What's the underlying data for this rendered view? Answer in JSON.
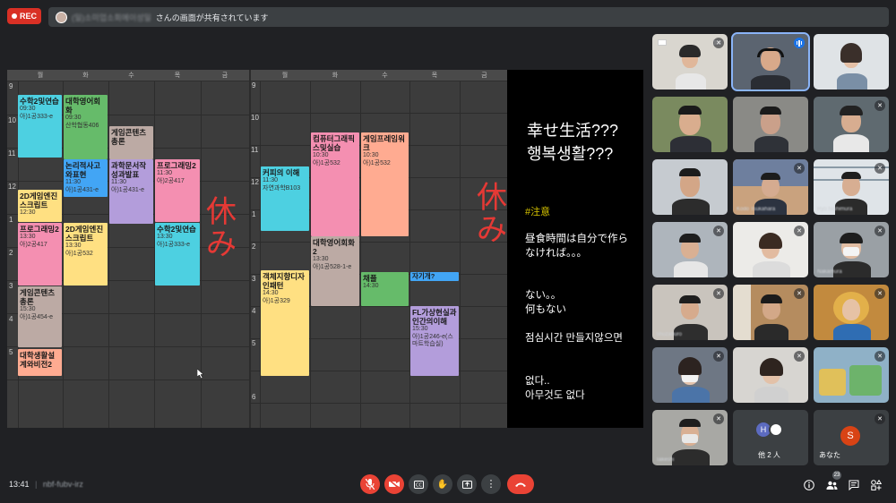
{
  "top_bar": {
    "rec_label": "REC",
    "sharer_name": "(일)소미업소회에이성일",
    "share_message": "さんの画面が共有されています"
  },
  "calendar": {
    "hours_left": [
      "9",
      "10",
      "11",
      "12",
      "1",
      "2",
      "3",
      "4",
      "5"
    ],
    "hours_right": [
      "9",
      "10",
      "11",
      "12",
      "1",
      "2",
      "3",
      "4",
      "5",
      "6"
    ],
    "days": [
      "월",
      "화",
      "수",
      "목",
      "금"
    ],
    "break_mark": "休み",
    "left_events": [
      {
        "title": "수학2및연습",
        "time": "09:30",
        "room": "아)1공333-e"
      },
      {
        "title": "대학영어회화",
        "time": "09:30",
        "room": "산학협동406"
      },
      {
        "title": "게임콘텐츠총론",
        "time": "",
        "room": ""
      },
      {
        "title": "논리적사고와표현",
        "time": "11:30",
        "room": "아)1공431-e"
      },
      {
        "title": "과학문서작성과발표",
        "time": "11:30",
        "room": "아)1공431-e"
      },
      {
        "title": "프로그래밍2",
        "time": "11:30",
        "room": "아)2공417"
      },
      {
        "title": "2D게임엔진스크립트",
        "time": "12:30",
        "room": ""
      },
      {
        "title": "프로그래밍2",
        "time": "13:30",
        "room": "아)2공417"
      },
      {
        "title": "2D게임엔진스크립트",
        "time": "13:30",
        "room": "아)1공532"
      },
      {
        "title": "수학2및연습",
        "time": "13:30",
        "room": "아)1공333-e"
      },
      {
        "title": "게임콘텐츠총론",
        "time": "15:30",
        "room": "아)1공454-e"
      },
      {
        "title": "대학생활설계와비전2",
        "time": "",
        "room": ""
      }
    ],
    "right_events": [
      {
        "title": "컴퓨터그래픽스및실습",
        "time": "10:30",
        "room": "아)1공532"
      },
      {
        "title": "게임프레임워크",
        "time": "10:30",
        "room": "아)1공532"
      },
      {
        "title": "커피의 이해",
        "time": "11:30",
        "room": "자연과학B103"
      },
      {
        "title": "대학영어회화2",
        "time": "13:30",
        "room": "아)1공528-1-e"
      },
      {
        "title": "객체지향디자인패턴",
        "time": "14:30",
        "room": "아)1공329"
      },
      {
        "title": "채플",
        "time": "14:30",
        "room": ""
      },
      {
        "title": "자기개?",
        "time": "",
        "room": ""
      },
      {
        "title": "FL가상현실과인간의이해",
        "time": "15:30",
        "room": "아)1공246-e(스마트학습실)"
      }
    ]
  },
  "note": {
    "title_ja": "幸せ生活???",
    "title_ko": "행복생활???",
    "hashtag": "#注意",
    "p1": "昼食時間は自分で作らなければ。。。",
    "p2a": "ない。。",
    "p2b": "何もない",
    "p3": "점심시간 만들지않으면",
    "p4a": "없다..",
    "p4b": "아무것도 없다"
  },
  "participants": {
    "tiles": [
      {
        "name": "",
        "mic": "muted"
      },
      {
        "name": "",
        "mic": "speaking"
      },
      {
        "name": "",
        "mic": "none"
      },
      {
        "name": "",
        "mic": "none"
      },
      {
        "name": "",
        "mic": "none"
      },
      {
        "name": "",
        "mic": "muted"
      },
      {
        "name": "",
        "mic": "none"
      },
      {
        "name": "Kodo Tsukahara",
        "mic": "muted"
      },
      {
        "name": "Ryo Nishimura",
        "mic": "muted"
      },
      {
        "name": "",
        "mic": "muted"
      },
      {
        "name": "",
        "mic": "muted"
      },
      {
        "name": "Nakamura",
        "mic": "muted"
      },
      {
        "name": "Shuzaburo",
        "mic": "muted"
      },
      {
        "name": "",
        "mic": "muted"
      },
      {
        "name": "",
        "mic": "muted"
      },
      {
        "name": "",
        "mic": "muted"
      },
      {
        "name": "",
        "mic": "muted"
      },
      {
        "name": "",
        "mic": "muted"
      },
      {
        "name": "Takeshi",
        "mic": "muted"
      }
    ],
    "others_label": "他 2 人",
    "others_initial": "H",
    "self_label": "あなた",
    "self_initial": "S"
  },
  "bottom_bar": {
    "time": "13:41",
    "separator": "|",
    "meeting_code": "nbf-fubv-irz",
    "people_count": "23"
  },
  "colors": {
    "rec": "#d93025",
    "leave": "#ea4335",
    "active_speaker": "#8ab4f8",
    "break_text": "#e53935"
  }
}
